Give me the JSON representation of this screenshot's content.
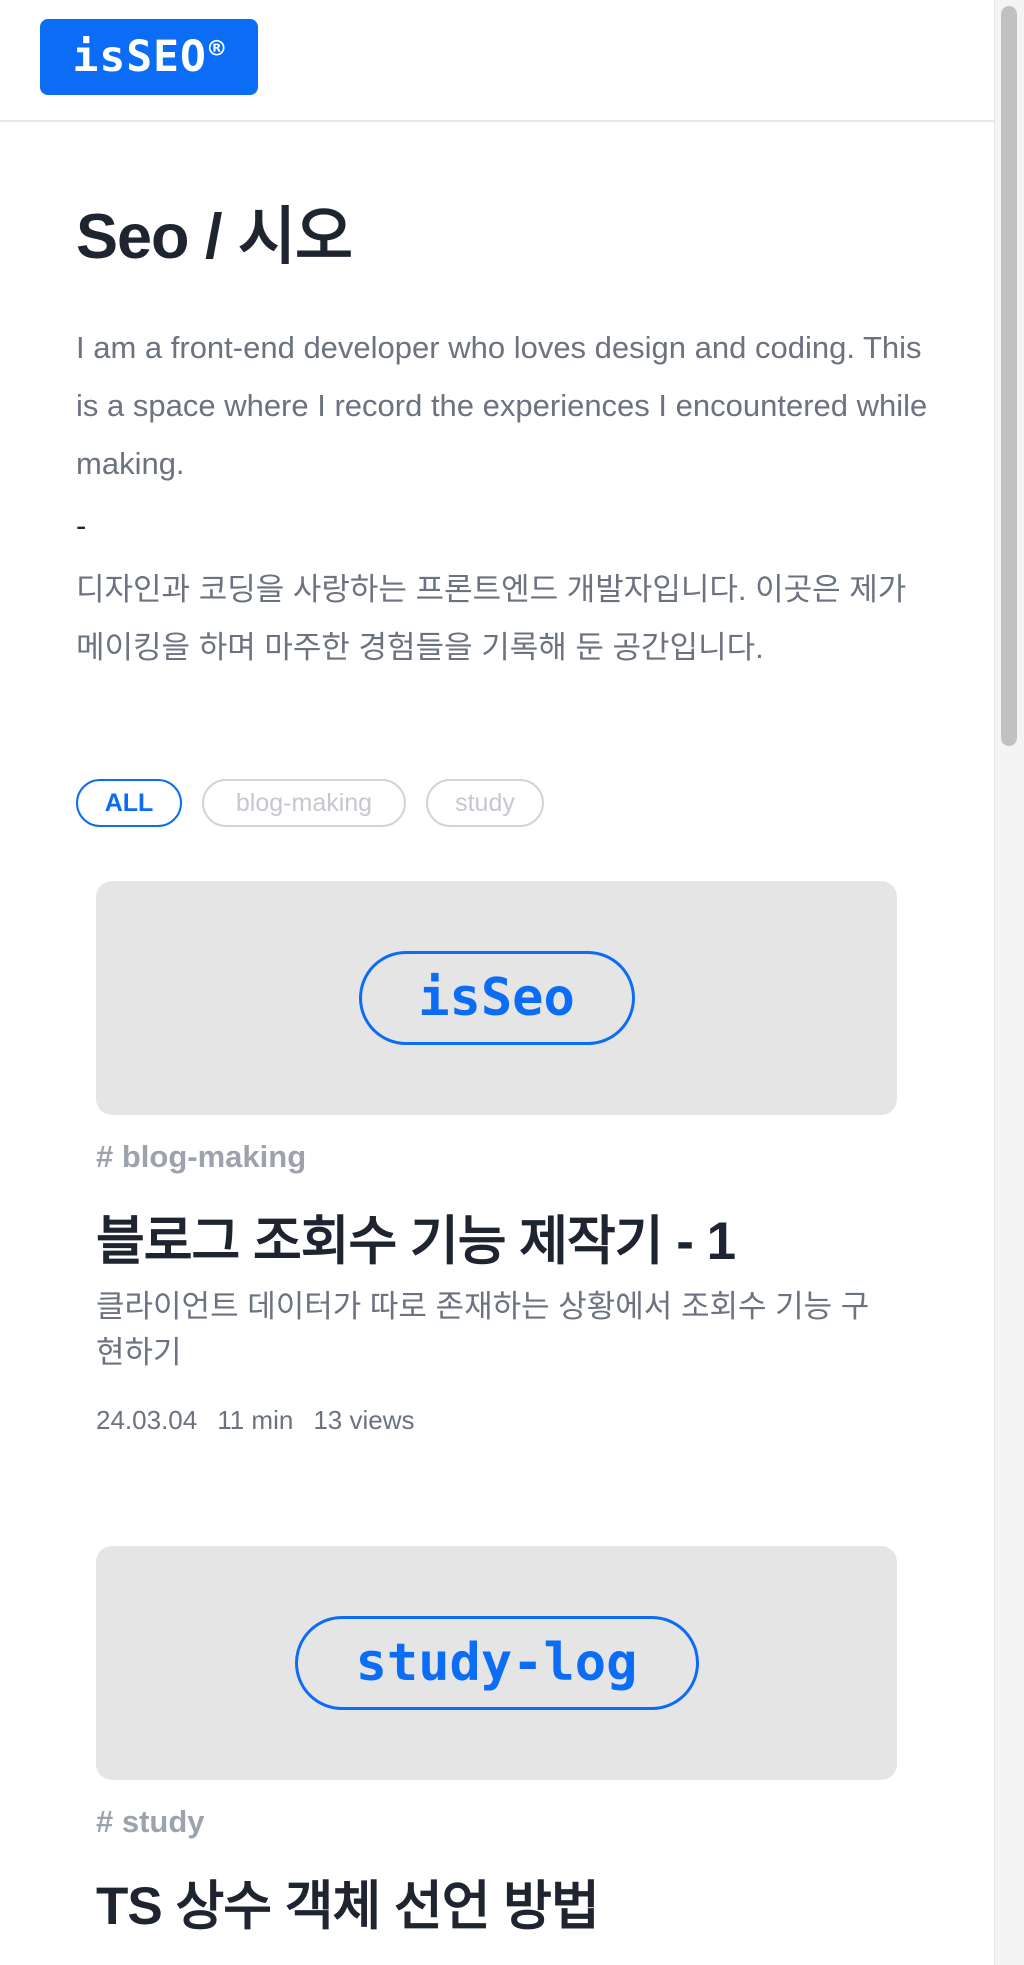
{
  "header": {
    "logo_text": "isSEO",
    "logo_mark": "®"
  },
  "intro": {
    "title": "Seo / 시오",
    "bio_en": "I am a front-end developer who loves design and coding. This is a space where I record the experiences I encountered while making.",
    "separator": "-",
    "bio_kr": "디자인과 코딩을 사랑하는 프론트엔드 개발자입니다. 이곳은 제가 메이킹을 하며 마주한 경험들을 기록해 둔 공간입니다."
  },
  "filters": [
    {
      "label": "ALL",
      "active": true
    },
    {
      "label": "blog-making",
      "active": false
    },
    {
      "label": "study",
      "active": false
    }
  ],
  "posts": [
    {
      "thumb_label": "isSeo",
      "tag": "# blog-making",
      "title": "블로그 조회수 기능 제작기 - 1",
      "description": "클라이언트 데이터가 따로 존재하는 상황에서 조회수 기능 구현하기",
      "date": "24.03.04",
      "read_time": "11 min",
      "views": "13 views"
    },
    {
      "thumb_label": "study-log",
      "tag": "# study",
      "title": "TS 상수 객체 선언 방법"
    }
  ],
  "colors": {
    "accent": "#0b6cf5",
    "text_dark": "#1e2530",
    "text_muted": "#6b7280",
    "thumb_bg": "#e5e5e5"
  }
}
